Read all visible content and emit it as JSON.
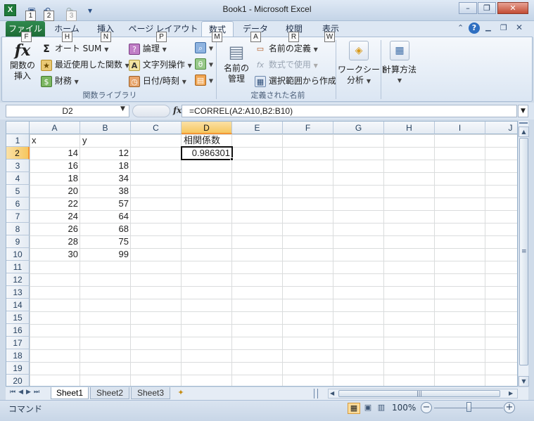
{
  "window": {
    "title": "Book1  -  Microsoft Excel",
    "app_icon": "X",
    "qat_keytips": [
      "1",
      "2",
      "3"
    ],
    "controls": {
      "minimize": "–",
      "restore": "❐",
      "close": "✕"
    }
  },
  "ribbon": {
    "tabs": [
      {
        "label": "ファイル",
        "keytip": "F"
      },
      {
        "label": "ホーム",
        "keytip": "H"
      },
      {
        "label": "挿入",
        "keytip": "N"
      },
      {
        "label": "ページ レイアウト",
        "keytip": "P"
      },
      {
        "label": "数式",
        "keytip": "M"
      },
      {
        "label": "データ",
        "keytip": "A"
      },
      {
        "label": "校閲",
        "keytip": "R"
      },
      {
        "label": "表示",
        "keytip": "W"
      }
    ],
    "function_library": {
      "insert_function": [
        "関数の",
        "挿入"
      ],
      "autosum": "オート SUM",
      "recent": "最近使用した関数",
      "financial": "財務",
      "logical": "論理",
      "text": "文字列操作",
      "datetime": "日付/時刻",
      "group_label": "関数ライブラリ"
    },
    "defined_names": {
      "name_manager": [
        "名前の",
        "管理"
      ],
      "define_name": "名前の定義",
      "use_in_formula": "数式で使用",
      "create_from_selection": "選択範囲から作成",
      "group_label": "定義された名前"
    },
    "audit": {
      "watch_window": [
        "ワークシート",
        "分析"
      ]
    },
    "calculation": {
      "calc_options": "計算方法"
    }
  },
  "formula_bar": {
    "name_box": "D2",
    "fx_label": "fx",
    "formula": "=CORREL(A2:A10,B2:B10)"
  },
  "sheet": {
    "columns": [
      "A",
      "B",
      "C",
      "D",
      "E",
      "F",
      "G",
      "H",
      "I",
      "J"
    ],
    "rows": [
      "1",
      "2",
      "3",
      "4",
      "5",
      "6",
      "7",
      "8",
      "9",
      "10",
      "11",
      "12",
      "13",
      "14",
      "15",
      "16",
      "17",
      "18",
      "19",
      "20"
    ],
    "selected_column": "D",
    "selected_row": "2",
    "cells": {
      "A1": "x",
      "B1": "y",
      "D1": "相関係数",
      "A2": "14",
      "B2": "12",
      "D2": "0.986301",
      "A3": "16",
      "B3": "18",
      "A4": "18",
      "B4": "34",
      "A5": "20",
      "B5": "38",
      "A6": "22",
      "B6": "57",
      "A7": "24",
      "B7": "64",
      "A8": "26",
      "B8": "68",
      "A9": "28",
      "B9": "75",
      "A10": "30",
      "B10": "99"
    }
  },
  "sheet_tabs": [
    "Sheet1",
    "Sheet2",
    "Sheet3"
  ],
  "status_bar": {
    "mode": "コマンド",
    "zoom": "100%"
  }
}
